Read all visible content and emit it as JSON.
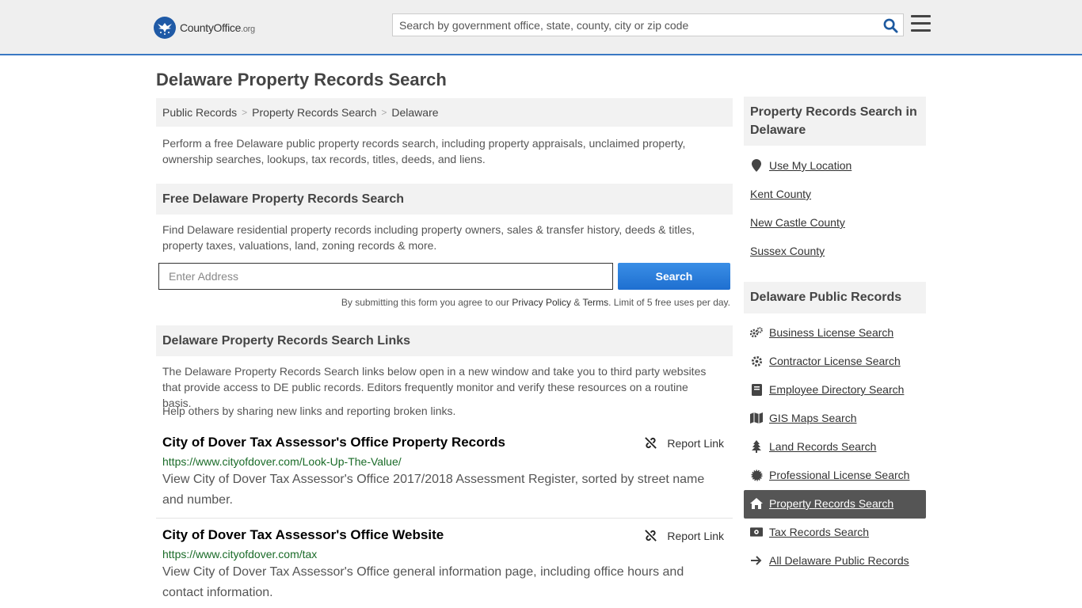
{
  "header": {
    "logo_name": "CountyOffice",
    "logo_org": ".org",
    "search_placeholder": "Search by government office, state, county, city or zip code"
  },
  "page": {
    "title": "Delaware Property Records Search",
    "breadcrumb": [
      "Public Records",
      "Property Records Search",
      "Delaware"
    ],
    "intro": "Perform a free Delaware public property records search, including property appraisals, unclaimed property, ownership searches, lookups, tax records, titles, deeds, and liens."
  },
  "free_search": {
    "heading": "Free Delaware Property Records Search",
    "description": "Find Delaware residential property records including property owners, sales & transfer history, deeds & titles, property taxes, valuations, land, zoning records & more.",
    "address_placeholder": "Enter Address",
    "button_label": "Search",
    "terms_prefix": "By submitting this form you agree to our ",
    "privacy_label": "Privacy Policy",
    "terms_amp": " & ",
    "terms_label": "Terms",
    "terms_suffix": ". Limit of 5 free uses per day."
  },
  "links_section": {
    "heading": "Delaware Property Records Search Links",
    "description": "The Delaware Property Records Search links below open in a new window and take you to third party websites that provide access to DE public records. Editors frequently monitor and verify these resources on a routine basis.",
    "help_prefix": "Help others by sharing ",
    "help_link": "new links",
    "help_suffix": " and reporting broken links.",
    "report_label": "Report Link",
    "items": [
      {
        "title": "City of Dover Tax Assessor's Office Property Records",
        "url": "https://www.cityofdover.com/Look-Up-The-Value/",
        "description": "View City of Dover Tax Assessor's Office 2017/2018 Assessment Register, sorted by street name and number."
      },
      {
        "title": "City of Dover Tax Assessor's Office Website",
        "url": "https://www.cityofdover.com/tax",
        "description": "View City of Dover Tax Assessor's Office general information page, including office hours and contact information."
      }
    ]
  },
  "sidebar": {
    "section1_title": "Property Records Search in Delaware",
    "use_location": "Use My Location",
    "counties": [
      "Kent County",
      "New Castle County",
      "Sussex County"
    ],
    "section2_title": "Delaware Public Records",
    "records": [
      {
        "label": "Business License Search",
        "icon": "gears-icon"
      },
      {
        "label": "Contractor License Search",
        "icon": "gear-icon"
      },
      {
        "label": "Employee Directory Search",
        "icon": "book-icon"
      },
      {
        "label": "GIS Maps Search",
        "icon": "map-icon"
      },
      {
        "label": "Land Records Search",
        "icon": "tree-icon"
      },
      {
        "label": "Professional License Search",
        "icon": "certificate-icon"
      },
      {
        "label": "Property Records Search",
        "icon": "home-icon"
      },
      {
        "label": "Tax Records Search",
        "icon": "money-icon"
      },
      {
        "label": "All Delaware Public Records",
        "icon": "arrow-right-icon"
      }
    ]
  },
  "colors": {
    "accent": "#3a78c3",
    "button": "#1e6fd0",
    "url_green": "#1a6b28",
    "active_bg": "#555555"
  }
}
